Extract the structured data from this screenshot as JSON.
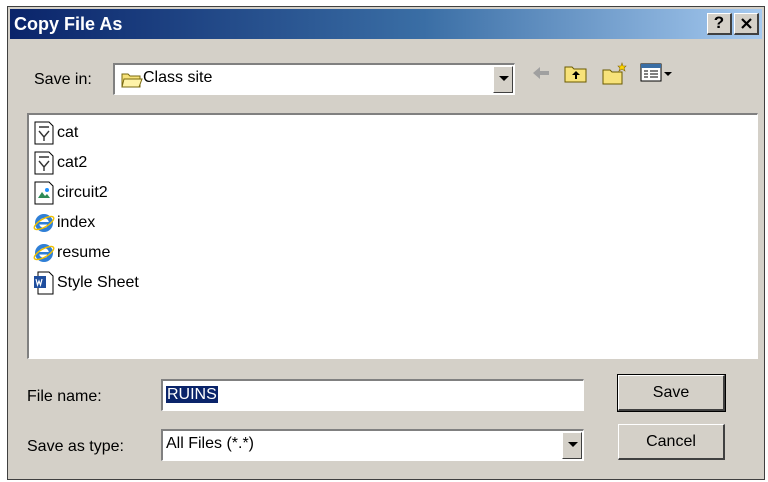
{
  "window": {
    "title": "Copy File As",
    "help_label": "?",
    "close_label": "✕"
  },
  "save_in": {
    "label": "Save in:",
    "value": "Class site"
  },
  "toolbar": {
    "icons": [
      "back-arrow-icon",
      "up-one-level-icon",
      "new-folder-icon",
      "view-menu-icon"
    ]
  },
  "files": [
    {
      "name": "cat",
      "icon": "document-icon"
    },
    {
      "name": "cat2",
      "icon": "document-icon"
    },
    {
      "name": "circuit2",
      "icon": "image-icon"
    },
    {
      "name": "index",
      "icon": "internet-explorer-icon"
    },
    {
      "name": "resume",
      "icon": "internet-explorer-icon"
    },
    {
      "name": "Style Sheet",
      "icon": "word-document-icon"
    }
  ],
  "file_name": {
    "label": "File name:",
    "value": "RUINS"
  },
  "save_as_type": {
    "label": "Save as type:",
    "value": "All Files (*.*)"
  },
  "buttons": {
    "save": "Save",
    "cancel": "Cancel"
  },
  "colors": {
    "title_bar": "#0a246a",
    "dialog_bg": "#d4d0c8",
    "selection": "#0a246a"
  }
}
